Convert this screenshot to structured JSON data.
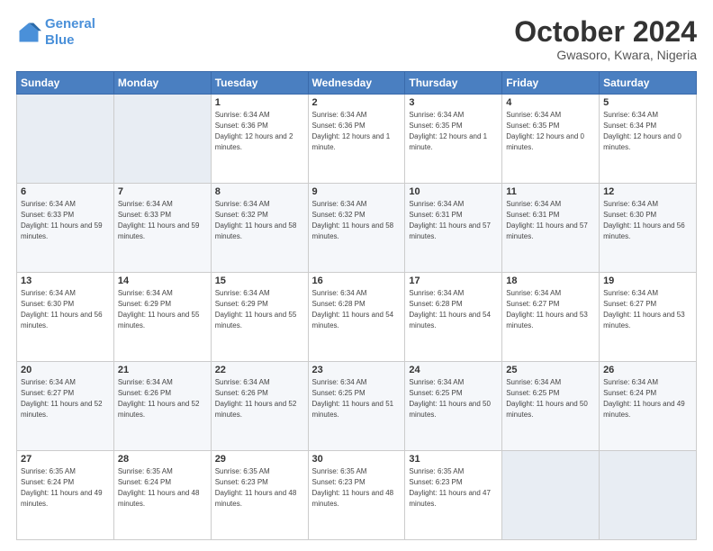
{
  "header": {
    "logo_line1": "General",
    "logo_line2": "Blue",
    "title": "October 2024",
    "subtitle": "Gwasoro, Kwara, Nigeria"
  },
  "columns": [
    "Sunday",
    "Monday",
    "Tuesday",
    "Wednesday",
    "Thursday",
    "Friday",
    "Saturday"
  ],
  "weeks": [
    [
      {
        "day": "",
        "sunrise": "",
        "sunset": "",
        "daylight": ""
      },
      {
        "day": "",
        "sunrise": "",
        "sunset": "",
        "daylight": ""
      },
      {
        "day": "1",
        "sunrise": "Sunrise: 6:34 AM",
        "sunset": "Sunset: 6:36 PM",
        "daylight": "Daylight: 12 hours and 2 minutes."
      },
      {
        "day": "2",
        "sunrise": "Sunrise: 6:34 AM",
        "sunset": "Sunset: 6:36 PM",
        "daylight": "Daylight: 12 hours and 1 minute."
      },
      {
        "day": "3",
        "sunrise": "Sunrise: 6:34 AM",
        "sunset": "Sunset: 6:35 PM",
        "daylight": "Daylight: 12 hours and 1 minute."
      },
      {
        "day": "4",
        "sunrise": "Sunrise: 6:34 AM",
        "sunset": "Sunset: 6:35 PM",
        "daylight": "Daylight: 12 hours and 0 minutes."
      },
      {
        "day": "5",
        "sunrise": "Sunrise: 6:34 AM",
        "sunset": "Sunset: 6:34 PM",
        "daylight": "Daylight: 12 hours and 0 minutes."
      }
    ],
    [
      {
        "day": "6",
        "sunrise": "Sunrise: 6:34 AM",
        "sunset": "Sunset: 6:33 PM",
        "daylight": "Daylight: 11 hours and 59 minutes."
      },
      {
        "day": "7",
        "sunrise": "Sunrise: 6:34 AM",
        "sunset": "Sunset: 6:33 PM",
        "daylight": "Daylight: 11 hours and 59 minutes."
      },
      {
        "day": "8",
        "sunrise": "Sunrise: 6:34 AM",
        "sunset": "Sunset: 6:32 PM",
        "daylight": "Daylight: 11 hours and 58 minutes."
      },
      {
        "day": "9",
        "sunrise": "Sunrise: 6:34 AM",
        "sunset": "Sunset: 6:32 PM",
        "daylight": "Daylight: 11 hours and 58 minutes."
      },
      {
        "day": "10",
        "sunrise": "Sunrise: 6:34 AM",
        "sunset": "Sunset: 6:31 PM",
        "daylight": "Daylight: 11 hours and 57 minutes."
      },
      {
        "day": "11",
        "sunrise": "Sunrise: 6:34 AM",
        "sunset": "Sunset: 6:31 PM",
        "daylight": "Daylight: 11 hours and 57 minutes."
      },
      {
        "day": "12",
        "sunrise": "Sunrise: 6:34 AM",
        "sunset": "Sunset: 6:30 PM",
        "daylight": "Daylight: 11 hours and 56 minutes."
      }
    ],
    [
      {
        "day": "13",
        "sunrise": "Sunrise: 6:34 AM",
        "sunset": "Sunset: 6:30 PM",
        "daylight": "Daylight: 11 hours and 56 minutes."
      },
      {
        "day": "14",
        "sunrise": "Sunrise: 6:34 AM",
        "sunset": "Sunset: 6:29 PM",
        "daylight": "Daylight: 11 hours and 55 minutes."
      },
      {
        "day": "15",
        "sunrise": "Sunrise: 6:34 AM",
        "sunset": "Sunset: 6:29 PM",
        "daylight": "Daylight: 11 hours and 55 minutes."
      },
      {
        "day": "16",
        "sunrise": "Sunrise: 6:34 AM",
        "sunset": "Sunset: 6:28 PM",
        "daylight": "Daylight: 11 hours and 54 minutes."
      },
      {
        "day": "17",
        "sunrise": "Sunrise: 6:34 AM",
        "sunset": "Sunset: 6:28 PM",
        "daylight": "Daylight: 11 hours and 54 minutes."
      },
      {
        "day": "18",
        "sunrise": "Sunrise: 6:34 AM",
        "sunset": "Sunset: 6:27 PM",
        "daylight": "Daylight: 11 hours and 53 minutes."
      },
      {
        "day": "19",
        "sunrise": "Sunrise: 6:34 AM",
        "sunset": "Sunset: 6:27 PM",
        "daylight": "Daylight: 11 hours and 53 minutes."
      }
    ],
    [
      {
        "day": "20",
        "sunrise": "Sunrise: 6:34 AM",
        "sunset": "Sunset: 6:27 PM",
        "daylight": "Daylight: 11 hours and 52 minutes."
      },
      {
        "day": "21",
        "sunrise": "Sunrise: 6:34 AM",
        "sunset": "Sunset: 6:26 PM",
        "daylight": "Daylight: 11 hours and 52 minutes."
      },
      {
        "day": "22",
        "sunrise": "Sunrise: 6:34 AM",
        "sunset": "Sunset: 6:26 PM",
        "daylight": "Daylight: 11 hours and 52 minutes."
      },
      {
        "day": "23",
        "sunrise": "Sunrise: 6:34 AM",
        "sunset": "Sunset: 6:25 PM",
        "daylight": "Daylight: 11 hours and 51 minutes."
      },
      {
        "day": "24",
        "sunrise": "Sunrise: 6:34 AM",
        "sunset": "Sunset: 6:25 PM",
        "daylight": "Daylight: 11 hours and 50 minutes."
      },
      {
        "day": "25",
        "sunrise": "Sunrise: 6:34 AM",
        "sunset": "Sunset: 6:25 PM",
        "daylight": "Daylight: 11 hours and 50 minutes."
      },
      {
        "day": "26",
        "sunrise": "Sunrise: 6:34 AM",
        "sunset": "Sunset: 6:24 PM",
        "daylight": "Daylight: 11 hours and 49 minutes."
      }
    ],
    [
      {
        "day": "27",
        "sunrise": "Sunrise: 6:35 AM",
        "sunset": "Sunset: 6:24 PM",
        "daylight": "Daylight: 11 hours and 49 minutes."
      },
      {
        "day": "28",
        "sunrise": "Sunrise: 6:35 AM",
        "sunset": "Sunset: 6:24 PM",
        "daylight": "Daylight: 11 hours and 48 minutes."
      },
      {
        "day": "29",
        "sunrise": "Sunrise: 6:35 AM",
        "sunset": "Sunset: 6:23 PM",
        "daylight": "Daylight: 11 hours and 48 minutes."
      },
      {
        "day": "30",
        "sunrise": "Sunrise: 6:35 AM",
        "sunset": "Sunset: 6:23 PM",
        "daylight": "Daylight: 11 hours and 48 minutes."
      },
      {
        "day": "31",
        "sunrise": "Sunrise: 6:35 AM",
        "sunset": "Sunset: 6:23 PM",
        "daylight": "Daylight: 11 hours and 47 minutes."
      },
      {
        "day": "",
        "sunrise": "",
        "sunset": "",
        "daylight": ""
      },
      {
        "day": "",
        "sunrise": "",
        "sunset": "",
        "daylight": ""
      }
    ]
  ]
}
